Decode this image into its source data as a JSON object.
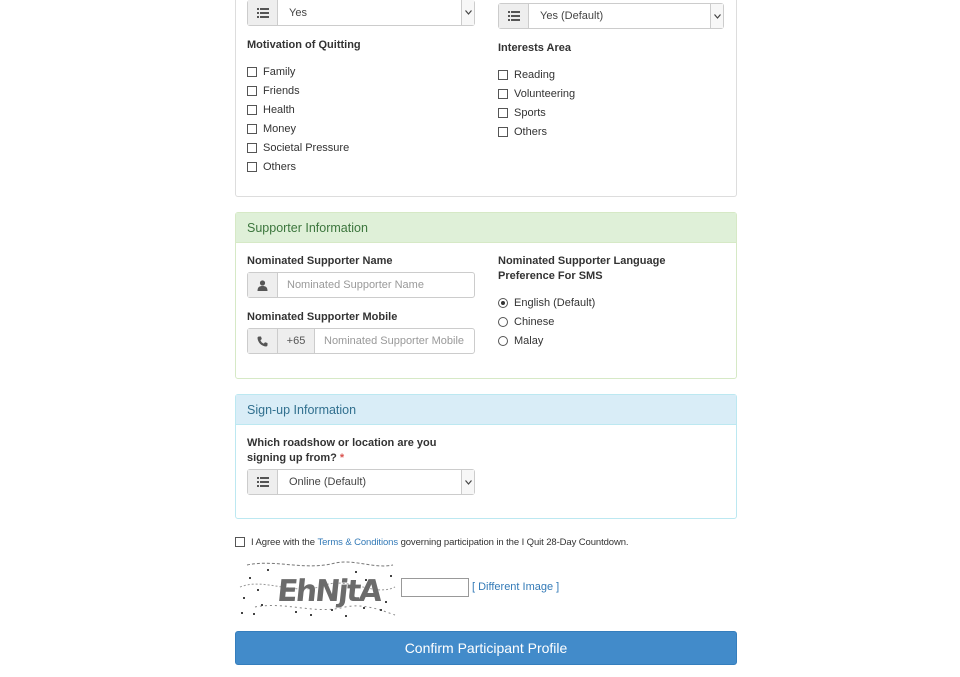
{
  "top_panel": {
    "left_select": {
      "value": "Yes"
    },
    "right_select": {
      "value": "Yes (Default)"
    },
    "motivation": {
      "label": "Motivation of Quitting",
      "options": [
        "Family",
        "Friends",
        "Health",
        "Money",
        "Societal Pressure",
        "Others"
      ]
    },
    "interests": {
      "label": "Interests Area",
      "options": [
        "Reading",
        "Volunteering",
        "Sports",
        "Others"
      ]
    }
  },
  "supporter": {
    "heading": "Supporter Information",
    "name_label": "Nominated Supporter Name",
    "name_placeholder": "Nominated Supporter Name",
    "mobile_label": "Nominated Supporter Mobile",
    "mobile_prefix": "+65",
    "mobile_placeholder": "Nominated Supporter Mobile",
    "language_label_line1": "Nominated Supporter Language",
    "language_label_line2": "Preference For SMS",
    "languages": [
      "English (Default)",
      "Chinese",
      "Malay"
    ],
    "selected_language": "English (Default)"
  },
  "signup": {
    "heading": "Sign-up Information",
    "question_line1": "Which roadshow or location are you",
    "question_line2": "signing up from?",
    "required_mark": "*",
    "location_value": "Online (Default)"
  },
  "agreement": {
    "prefix": "I Agree with the",
    "link": "Terms & Conditions",
    "suffix": "governing participation in the I Quit 28-Day Countdown."
  },
  "captcha": {
    "image_text": "EhNjtA",
    "different_image_link": "[ Different Image ]"
  },
  "submit_label": "Confirm Participant Profile",
  "colors": {
    "supporter_head_bg": "#dff0d8",
    "supporter_head_text": "#3c763d",
    "signup_head_bg": "#d9edf7",
    "signup_head_text": "#31708f",
    "primary": "#428bca"
  }
}
